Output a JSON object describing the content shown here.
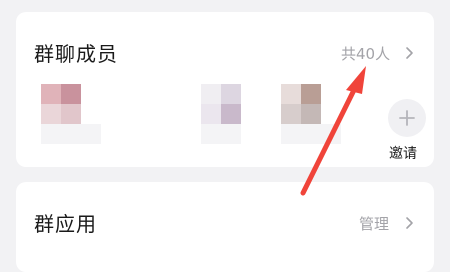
{
  "members": {
    "title": "群聊成员",
    "count_label": "共40人",
    "invite_label": "邀请"
  },
  "apps": {
    "title": "群应用",
    "manage_label": "管理"
  },
  "colors": {
    "background": "#f2f2f4",
    "card": "#ffffff",
    "title_text": "#1a1a1a",
    "secondary_text": "#a3a3a8",
    "annotation_arrow": "#f0443a"
  },
  "icons": {
    "chevron": "chevron-right-icon",
    "invite": "plus-icon"
  }
}
